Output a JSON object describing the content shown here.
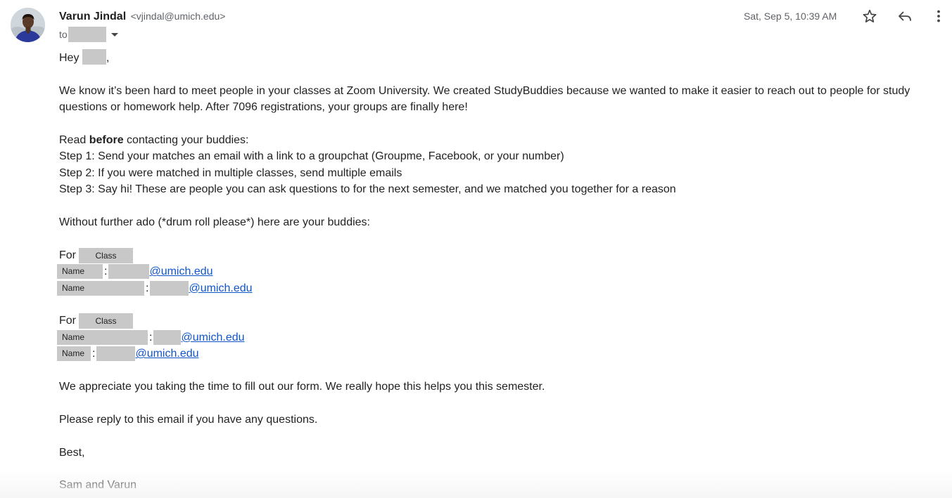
{
  "sender": {
    "name": "Varun Jindal",
    "email": "<vjindal@umich.edu>"
  },
  "recipient": {
    "to_label": "to"
  },
  "timestamp": "Sat, Sep 5, 10:39 AM",
  "icons": [
    "star-icon",
    "reply-icon",
    "more-vert-icon",
    "chevron-down-icon"
  ],
  "colors": {
    "link": "#1155cc",
    "redaction": "#c8c8c8",
    "meta_text": "#5f6368"
  },
  "body": {
    "greeting_prefix": "Hey",
    "greeting_suffix": ",",
    "intro": "We know it’s been hard to meet people in your classes at Zoom University. We created StudyBuddies because we wanted to make it easier to reach out to people for study questions or homework help. After 7096 registrations, your groups are finally here!",
    "read_prefix": "Read ",
    "read_bold": "before",
    "read_suffix": " contacting your buddies:",
    "steps": [
      "Step 1: Send your matches an email with a link to a groupchat (Groupme, Facebook, or your number)",
      "Step 2: If you were matched in multiple classes, send multiple emails",
      "Step 3: Say hi! These are people you can ask questions to for the next semester, and we matched you together for a reason"
    ],
    "buddies_intro": "Without further ado (*drum roll please*) here are your buddies:",
    "groups": [
      {
        "for_label": "For",
        "class_label": "Class",
        "buddies": [
          {
            "name_label": "Name",
            "colon": ":",
            "email_domain": "@umich.edu"
          },
          {
            "name_label": "Name",
            "colon": ":",
            "email_domain": "@umich.edu"
          }
        ]
      },
      {
        "for_label": "For",
        "class_label": "Class",
        "buddies": [
          {
            "name_label": "Name",
            "colon": ":",
            "email_domain": "@umich.edu"
          },
          {
            "name_label": "Name",
            "colon": ":",
            "email_domain": "@umich.edu"
          }
        ]
      }
    ],
    "appreciation": "We appreciate you taking the time to fill out our form. We really hope this helps you this semester.",
    "reply_note": "Please reply to this email if you have any questions.",
    "signoff": "Best,",
    "signature": "Sam and Varun"
  }
}
